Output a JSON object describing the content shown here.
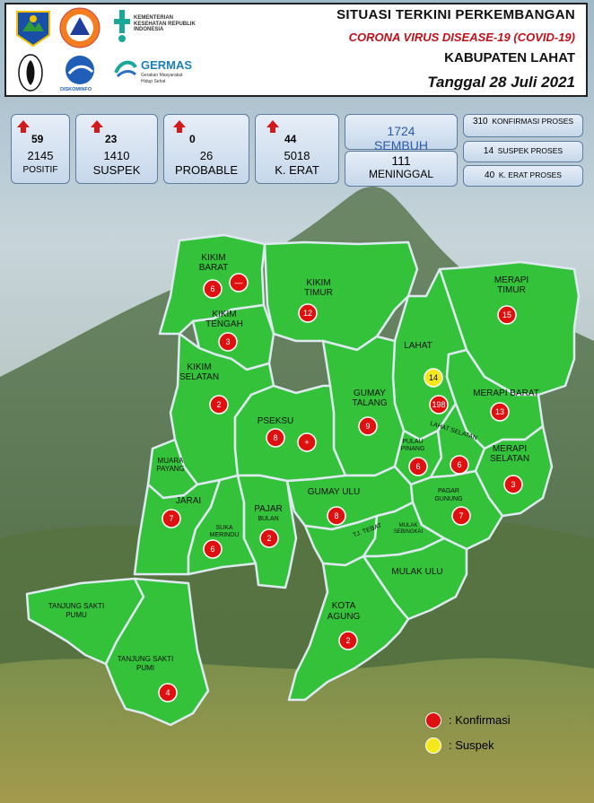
{
  "header": {
    "title_line1": "SITUASI TERKINI PERKEMBANGAN",
    "title_line2": "CORONA VIRUS DISEASE-19 (COVID-19)",
    "title_line3": "KABUPATEN LAHAT",
    "title_line4": "Tanggal 28 Juli 2021",
    "logo_kemenkes_text": "KEMENTERIAN KESEHATAN REPUBLIK INDONESIA",
    "logo_germas_text": "GERMAS",
    "logo_germas_sub": "Gerakan Masyarakat Hidup Sehat",
    "logo_diskominfo_text": "DISKOMINFO"
  },
  "stats": [
    {
      "increase": "59",
      "total": "2145",
      "label": "POSITIF"
    },
    {
      "increase": "23",
      "total": "1410",
      "label": "SUSPEK"
    },
    {
      "increase": "0",
      "total": "26",
      "label": "PROBABLE"
    },
    {
      "increase": "44",
      "total": "5018",
      "label": "K. ERAT"
    }
  ],
  "recovered": {
    "value": "1724",
    "label": "SEMBUH"
  },
  "deaths": {
    "value": "111",
    "label": "MENINGGAL"
  },
  "in_process": [
    {
      "value": "310",
      "label": "KONFIRMASI PROSES"
    },
    {
      "value": "14",
      "label": "SUSPEK PROSES"
    },
    {
      "value": "40",
      "label": "K. ERAT PROSES"
    }
  ],
  "map": {
    "region_fill": "#34c23b",
    "border_color": "#dfe9f2",
    "districts": [
      {
        "name": "KIKIM BARAT",
        "cases": [
          "6",
          "—"
        ]
      },
      {
        "name": "KIKIM TIMUR",
        "cases": [
          "12"
        ]
      },
      {
        "name": "KIKIM TENGAH",
        "cases": [
          "3"
        ]
      },
      {
        "name": "KIKIM SELATAN",
        "cases": [
          "2"
        ]
      },
      {
        "name": "MERAPI TIMUR",
        "cases": [
          "15"
        ]
      },
      {
        "name": "LAHAT",
        "cases": [
          "198"
        ],
        "suspects": [
          "14"
        ]
      },
      {
        "name": "MERAPI BARAT",
        "cases": [
          "13"
        ]
      },
      {
        "name": "GUMAY TALANG",
        "cases": [
          "9"
        ]
      },
      {
        "name": "PSEKSU",
        "cases": [
          "8",
          "+"
        ]
      },
      {
        "name": "PULAU PINANG",
        "cases": [
          "6"
        ]
      },
      {
        "name": "LAHAT SELATAN",
        "cases": [
          "6"
        ]
      },
      {
        "name": "MERAPI SELATAN",
        "cases": [
          "3"
        ]
      },
      {
        "name": "MUARA PAYANG",
        "cases": []
      },
      {
        "name": "JARAI",
        "cases": [
          "7"
        ]
      },
      {
        "name": "SUKA MERINDU",
        "cases": [
          "6"
        ]
      },
      {
        "name": "PAJAR BULAN",
        "cases": [
          "2"
        ]
      },
      {
        "name": "GUMAY ULU",
        "cases": [
          "8"
        ]
      },
      {
        "name": "PAGAR GUNUNG",
        "cases": [
          "7"
        ]
      },
      {
        "name": "TJ. TEBAT",
        "cases": []
      },
      {
        "name": "MULAK SEBINGKAI",
        "cases": []
      },
      {
        "name": "MULAK ULU",
        "cases": []
      },
      {
        "name": "KOTA AGUNG",
        "cases": [
          "2"
        ]
      },
      {
        "name": "TANJUNG SAKTI PUMU",
        "cases": []
      },
      {
        "name": "TANJUNG SAKTI PUMI",
        "cases": [
          "4"
        ]
      }
    ]
  },
  "legend": [
    {
      "label": ": Konfirmasi",
      "color": "#e01010"
    },
    {
      "label": ": Suspek",
      "color": "#f5e81a"
    }
  ]
}
